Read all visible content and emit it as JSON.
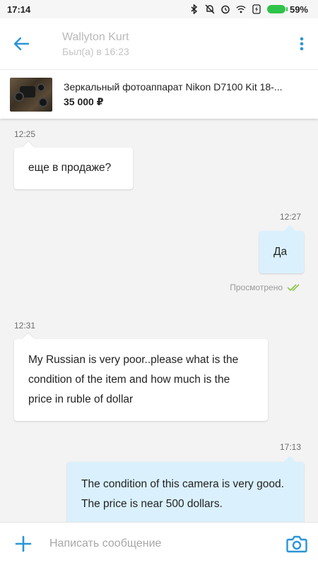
{
  "status_bar": {
    "time": "17:14",
    "battery": "59%",
    "icons": [
      "bluetooth-icon",
      "silent-icon",
      "alarm-icon",
      "wifi-icon",
      "charging-icon",
      "battery-icon"
    ]
  },
  "header": {
    "name": "Wallyton Kurt",
    "status": "Был(а) в 16:23",
    "back_icon": "arrow-left-icon",
    "menu_icon": "more-vertical-icon",
    "accent": "#2a95d8"
  },
  "product": {
    "title": "Зеркальный фотоаппарат Nikon D7100 Kit 18-...",
    "price": "35 000 ₽"
  },
  "messages": [
    {
      "direction": "in",
      "time": "12:25",
      "text": "еще в продаже?"
    },
    {
      "direction": "out",
      "time": "12:27",
      "text": "Да",
      "seen_label": "Просмотрено"
    },
    {
      "direction": "in",
      "time": "12:31",
      "text": "My Russian is very poor..please what is the condition of the item and how much is the price in ruble of dollar"
    },
    {
      "direction": "out",
      "time": "17:13",
      "text": "The condition of this camera is very good. The price is near 500 dollars."
    }
  ],
  "input": {
    "placeholder": "Написать сообщение",
    "value": ""
  },
  "colors": {
    "incoming_bubble": "#ffffff",
    "outgoing_bubble": "#daf1fd",
    "seen_check": "#8bc34a",
    "battery": "#2fc34a"
  }
}
